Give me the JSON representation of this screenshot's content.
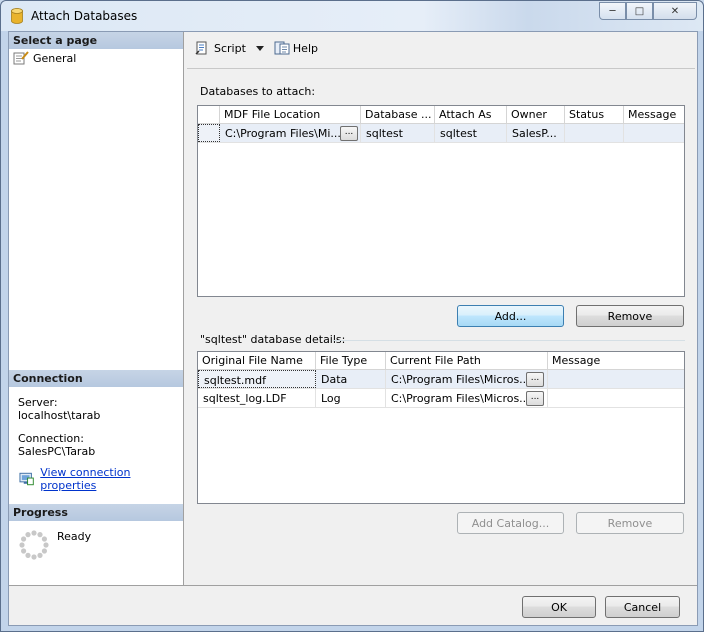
{
  "window": {
    "title": "Attach Databases",
    "caption": {
      "minimize": "─",
      "maximize": "□",
      "close": "✕"
    }
  },
  "left": {
    "select_page": "Select a page",
    "pages": [
      {
        "label": "General",
        "icon": "page-general-icon"
      }
    ],
    "connection": {
      "header": "Connection",
      "server_label": "Server:",
      "server_value": "localhost\\tarab",
      "connection_label": "Connection:",
      "connection_value": "SalesPC\\Tarab",
      "view_link": "View connection properties"
    },
    "progress": {
      "header": "Progress",
      "status": "Ready"
    }
  },
  "toolbar": {
    "script_label": "Script",
    "help_label": "Help"
  },
  "attach": {
    "label": "Databases to attach:",
    "columns": [
      "MDF File Location",
      "Database ...",
      "Attach As",
      "Owner",
      "Status",
      "Message"
    ],
    "rows": [
      {
        "mdf": "C:\\Program Files\\Mi...",
        "database": "sqltest",
        "attach_as": "sqltest",
        "owner": "SalesP...",
        "status": "",
        "message": ""
      }
    ],
    "browse_label": "...",
    "add_label": "Add...",
    "remove_label": "Remove"
  },
  "details": {
    "label": "\"sqltest\" database details:",
    "columns": [
      "Original File Name",
      "File Type",
      "Current File Path",
      "Message"
    ],
    "rows": [
      {
        "name": "sqltest.mdf",
        "type": "Data",
        "path": "C:\\Program Files\\Micros...",
        "message": ""
      },
      {
        "name": "sqltest_log.LDF",
        "type": "Log",
        "path": "C:\\Program Files\\Micros...",
        "message": ""
      }
    ],
    "browse_label": "...",
    "add_catalog_label": "Add Catalog...",
    "remove_label": "Remove"
  },
  "footer": {
    "ok_label": "OK",
    "cancel_label": "Cancel"
  }
}
